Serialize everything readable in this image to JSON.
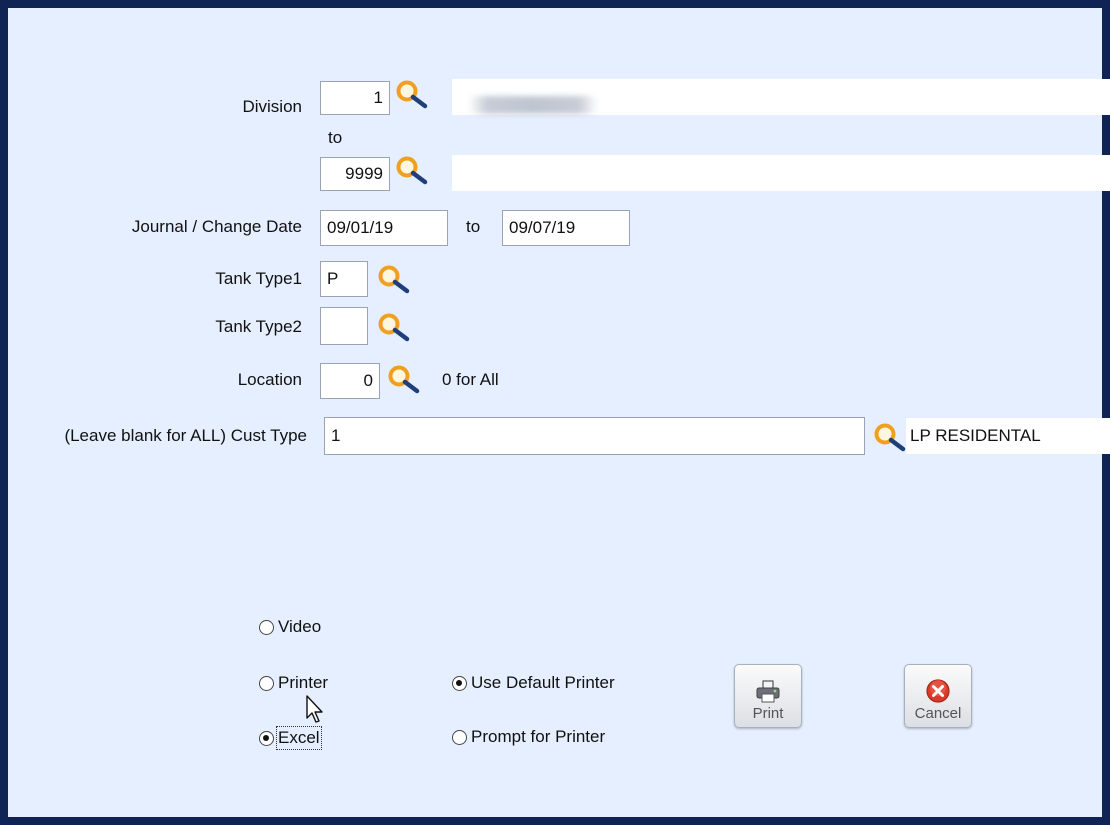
{
  "form": {
    "division": {
      "label": "Division",
      "from_value": "1",
      "to_label": "to",
      "to_value": "9999",
      "to_desc": ""
    },
    "journal_date": {
      "label": "Journal / Change Date",
      "from_value": "09/01/19",
      "to_label": "to",
      "to_value": "09/07/19"
    },
    "tank_type1": {
      "label": "Tank Type1",
      "value": "P"
    },
    "tank_type2": {
      "label": "Tank Type2",
      "value": ""
    },
    "location": {
      "label": "Location",
      "value": "0",
      "hint": "0 for All"
    },
    "cust_type": {
      "label": "(Leave blank for ALL) Cust Type",
      "value": "1",
      "desc": "LP RESIDENTAL"
    }
  },
  "output": {
    "video_label": "Video",
    "printer_label": "Printer",
    "excel_label": "Excel",
    "selected": "Excel"
  },
  "printer_options": {
    "default_label": "Use Default Printer",
    "prompt_label": "Prompt for Printer",
    "selected": "Use Default Printer"
  },
  "buttons": {
    "print_label": "Print",
    "cancel_label": "Cancel"
  },
  "icons": {
    "lookup": "magnifier-lookup-icon",
    "print": "printer-icon",
    "cancel": "cancel-x-icon"
  },
  "colors": {
    "background": "#e6efff",
    "border": "#0f2454",
    "magnifier": "#f0a020",
    "cancel": "#d93a2a"
  }
}
